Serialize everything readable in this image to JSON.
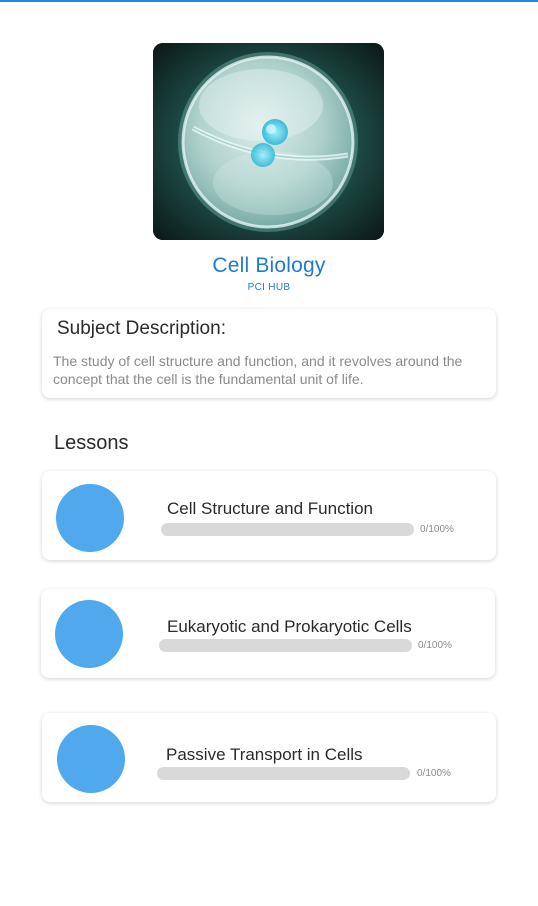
{
  "subject": {
    "title": "Cell Biology",
    "provider": "PCI HUB",
    "cover_image": "cell-division-image"
  },
  "description": {
    "heading": "Subject Description:",
    "body": "The study of cell structure and function, and it revolves around the concept that the cell is the fundamental unit of life."
  },
  "lessons_heading": "Lessons",
  "lessons": [
    {
      "title": "Cell Structure and Function",
      "progress": 0,
      "progress_label": "0/100%"
    },
    {
      "title": "Eukaryotic and Prokaryotic Cells",
      "progress": 0,
      "progress_label": "0/100%"
    },
    {
      "title": "Passive Transport in Cells",
      "progress": 0,
      "progress_label": "0/100%"
    }
  ],
  "colors": {
    "accent": "#1e7bd0",
    "lesson_icon": "#4fa9ec",
    "progress_track": "#d9d9d9"
  }
}
